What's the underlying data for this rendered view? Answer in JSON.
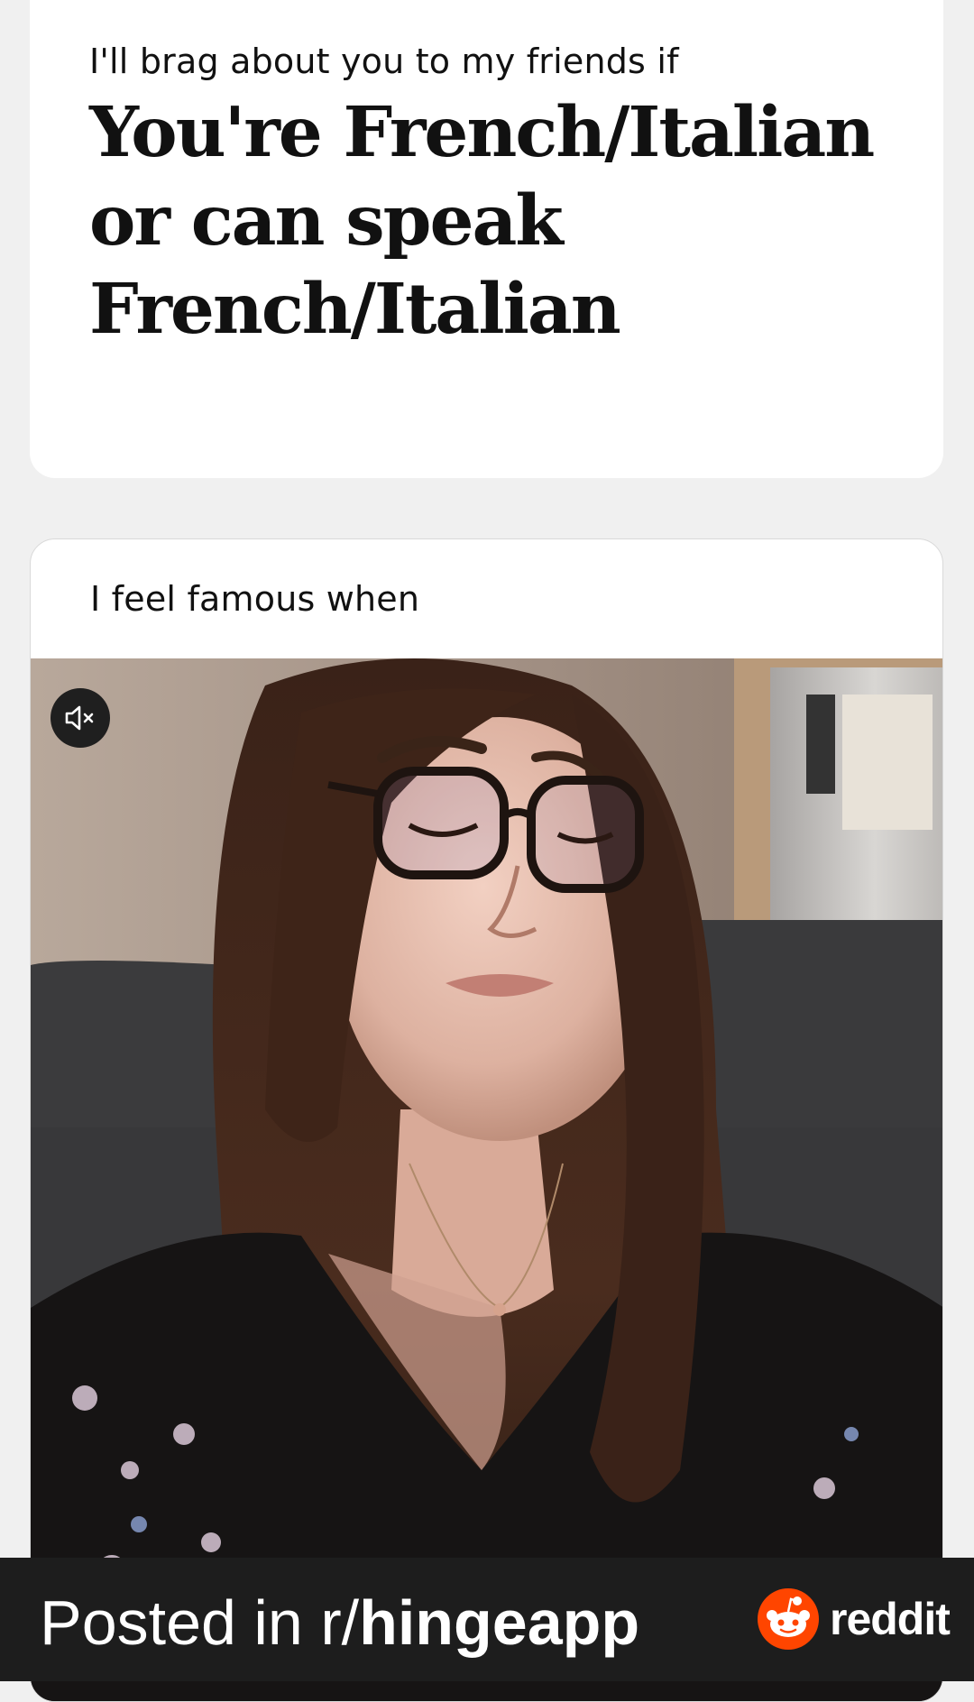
{
  "cards": [
    {
      "prompt": "I'll brag about you to my friends if",
      "answer": "You're French/Italian or can speak French/Italian"
    },
    {
      "prompt": "I feel famous when",
      "media": {
        "type": "video",
        "mute_icon": "speaker-muted-icon"
      }
    }
  ],
  "footer": {
    "posted_in": "Posted in ",
    "subreddit_prefix": "r/",
    "subreddit_name": "hingeapp",
    "brand_word": "reddit",
    "brand_icon": "reddit-snoo-icon",
    "brand_color": "#ff4500"
  }
}
